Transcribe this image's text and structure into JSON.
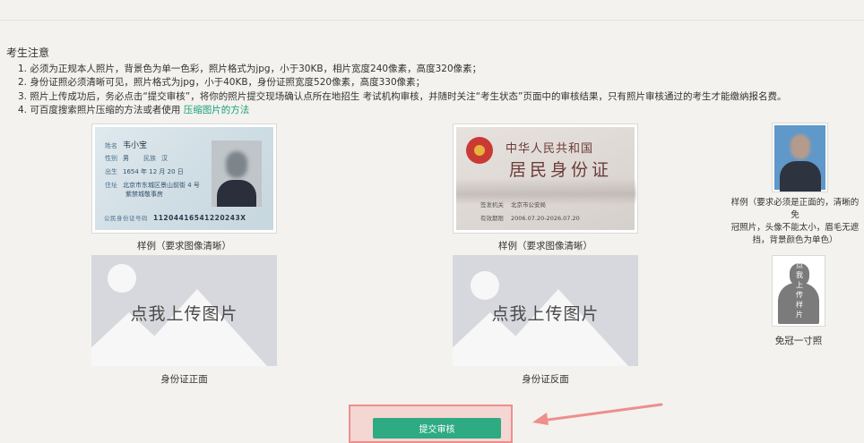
{
  "notice": {
    "title": "考生注意",
    "items": [
      "1. 必须为正规本人照片，背景色为单一色彩，照片格式为jpg，小于30KB，相片宽度240像素，高度320像素；",
      "2. 身份证照必须清晰可见，照片格式为jpg，小于40KB，身份证照宽度520像素，高度330像素；",
      "3. 照片上传成功后，务必点击“提交审核”，将你的照片提交现场确认点所在地招生 考试机构审核，并随时关注“考生状态”页面中的审核结果，只有照片审核通过的考生才能缴纳报名费。",
      "4. 可百度搜索照片压缩的方法或者使用 "
    ],
    "compress_link": "压缩图片的方法"
  },
  "samples": {
    "front_caption": "样例（要求图像清晰）",
    "back_caption": "样例（要求图像清晰）",
    "portrait_caption_lines": [
      "样例（要求必须是正面的，清晰的免",
      "冠照片，头像不能太小，眉毛无遮",
      "挡，背景颜色为单色）"
    ]
  },
  "id_front": {
    "name_label": "姓名",
    "name": "韦小宝",
    "sex_label": "性别",
    "sex": "男",
    "ethnic_label": "民族",
    "ethnic": "汉",
    "birth_label": "出生",
    "birth": "1654 年 12 月 20 日",
    "addr_label": "住址",
    "addr1": "北京市东城区景山前街 4 号",
    "addr2": "紫禁城敬事房",
    "num_label": "公民身份证号码",
    "num": "11204416541220243X"
  },
  "id_back": {
    "title1": "中华人民共和国",
    "title2": "居民身份证",
    "authority_label": "签发机关",
    "authority": "北京市公安局",
    "validity_label": "有效期限",
    "validity": "2006.07.20-2026.07.20"
  },
  "uploads": {
    "front_text": "点我上传图片",
    "back_text": "点我上传图片",
    "front_caption": "身份证正面",
    "back_caption": "身份证反面",
    "photo_vertical_text": [
      "点",
      "我",
      "上",
      "传",
      "样",
      "片"
    ],
    "photo_caption": "免冠一寸照"
  },
  "submit_label": "提交审核",
  "colors": {
    "accent": "#2eab82",
    "link": "#1aa07a",
    "highlight": "#ee8e8e",
    "placeholder": "#d7d8dd"
  }
}
